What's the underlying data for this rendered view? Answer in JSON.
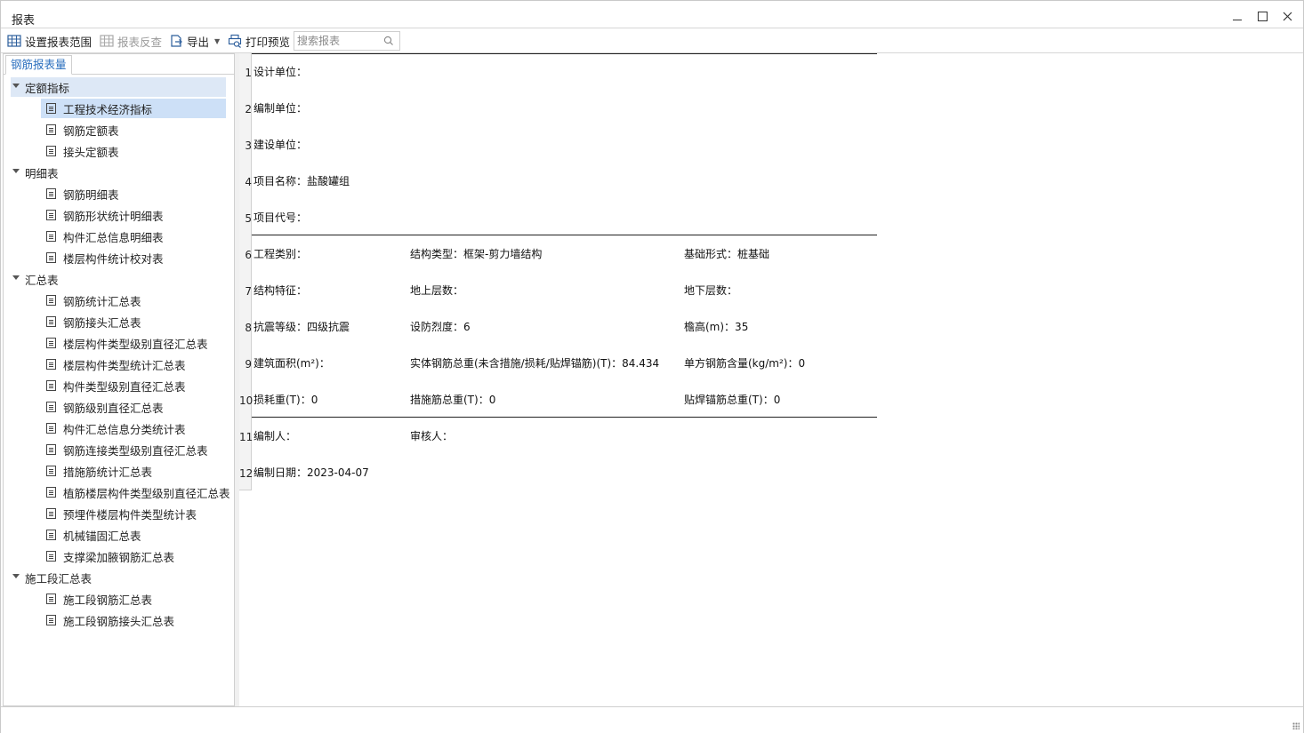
{
  "window": {
    "title": "报表"
  },
  "toolbar": {
    "set_range": "设置报表范围",
    "report_reverse": "报表反查",
    "export": "导出",
    "print_preview": "打印预览",
    "search_placeholder": "搜索报表"
  },
  "left_panel": {
    "tab": "钢筋报表量",
    "groups": [
      {
        "label": "定额指标",
        "items": [
          "工程技术经济指标",
          "钢筋定额表",
          "接头定额表"
        ]
      },
      {
        "label": "明细表",
        "items": [
          "钢筋明细表",
          "钢筋形状统计明细表",
          "构件汇总信息明细表",
          "楼层构件统计校对表"
        ]
      },
      {
        "label": "汇总表",
        "items": [
          "钢筋统计汇总表",
          "钢筋接头汇总表",
          "楼层构件类型级别直径汇总表",
          "楼层构件类型统计汇总表",
          "构件类型级别直径汇总表",
          "钢筋级别直径汇总表",
          "构件汇总信息分类统计表",
          "钢筋连接类型级别直径汇总表",
          "措施筋统计汇总表",
          "植筋楼层构件类型级别直径汇总表",
          "预埋件楼层构件类型统计表",
          "机械锚固汇总表",
          "支撑梁加腋钢筋汇总表"
        ]
      },
      {
        "label": "施工段汇总表",
        "items": [
          "施工段钢筋汇总表",
          "施工段钢筋接头汇总表"
        ]
      }
    ],
    "selected_item": "工程技术经济指标"
  },
  "report": {
    "row_numbers": [
      "1",
      "2",
      "3",
      "4",
      "5",
      "6",
      "7",
      "8",
      "9",
      "10",
      "11",
      "12"
    ],
    "rows": [
      [
        "设计单位："
      ],
      [
        "编制单位："
      ],
      [
        "建设单位："
      ],
      [
        "项目名称：盐酸罐组"
      ],
      [
        "项目代号："
      ],
      [
        "工程类别：",
        "结构类型：框架-剪力墙结构",
        "基础形式：桩基础"
      ],
      [
        "结构特征：",
        "地上层数：",
        "地下层数："
      ],
      [
        "抗震等级：四级抗震",
        "设防烈度：6",
        "檐高(m)：35"
      ],
      [
        "建筑面积(m²)：",
        "实体钢筋总重(未含措施/损耗/贴焊锚筋)(T)：84.434",
        "单方钢筋含量(kg/m²)：0"
      ],
      [
        "损耗重(T)：0",
        "措施筋总重(T)：0",
        "贴焊锚筋总重(T)：0"
      ],
      [
        "编制人：",
        "审核人："
      ],
      [
        "编制日期：2023-04-07"
      ]
    ]
  },
  "colors": {
    "accent": "#2b6fbe",
    "selection": "#cde0f7",
    "group_highlight": "#dde8f6"
  },
  "icons": [
    "set-range-icon",
    "report-reverse-icon",
    "export-icon",
    "print-preview-icon",
    "search-icon",
    "document-icon",
    "expand-caret-icon"
  ]
}
